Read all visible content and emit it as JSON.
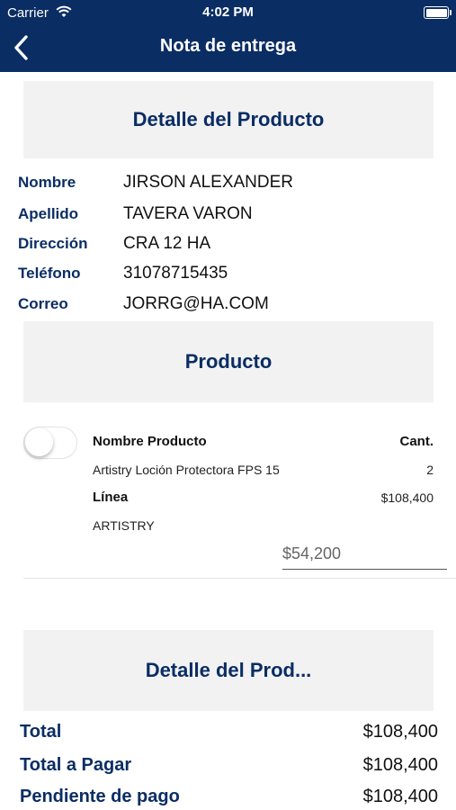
{
  "status_bar": {
    "carrier": "Carrier",
    "time": "4:02 PM"
  },
  "nav": {
    "title": "Nota de entrega"
  },
  "detail_header": "Detalle del  Producto",
  "customer": {
    "nombre_label": "Nombre",
    "nombre": "JIRSON ALEXANDER",
    "apellido_label": "Apellido",
    "apellido": "TAVERA VARON",
    "direccion_label": "Dirección",
    "direccion": "CRA 12 HA",
    "telefono_label": "Teléfono",
    "telefono": "31078715435",
    "correo_label": "Correo",
    "correo": "JORRG@HA.COM"
  },
  "product_header": "Producto",
  "product": {
    "name_header": "Nombre Producto",
    "qty_header": "Cant.",
    "name": "Artistry Loción Protectora FPS 15",
    "qty": "2",
    "line_label": "Línea",
    "line_total": "$108,400",
    "line": "ARTISTRY",
    "unit_price_input": "$54,200",
    "toggle_on": false
  },
  "summary_header": "Detalle del  Prod...",
  "totals": {
    "total_label": "Total",
    "total": "$108,400",
    "pagar_label": "Total a Pagar",
    "pagar": "$108,400",
    "pendiente_label": "Pendiente de pago",
    "pendiente": "$108,400"
  },
  "colors": {
    "nav_bg": "#0a2d63",
    "accent_text": "#0a2d63",
    "section_bg": "#f2f2f3"
  },
  "icons": {
    "back": "chevron-left-icon",
    "wifi": "wifi-icon",
    "battery": "battery-icon"
  }
}
